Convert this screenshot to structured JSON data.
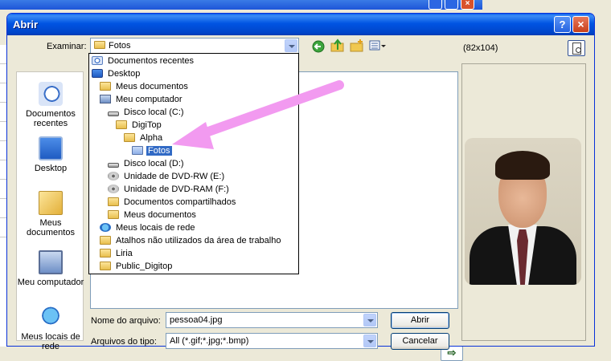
{
  "dialog": {
    "title": "Abrir",
    "help_icon": "?",
    "close_icon": "×"
  },
  "lookin": {
    "label": "Examinar:",
    "value": "Fotos"
  },
  "toolbar": {
    "icons": [
      "back-icon",
      "up-folder-icon",
      "new-folder-icon",
      "view-menu-icon"
    ]
  },
  "places": [
    {
      "label": "Documentos recentes",
      "icon": "recent-documents-icon"
    },
    {
      "label": "Desktop",
      "icon": "desktop-icon"
    },
    {
      "label": "Meus documentos",
      "icon": "my-documents-icon"
    },
    {
      "label": "Meu computador",
      "icon": "my-computer-icon"
    },
    {
      "label": "Meus locais de rede",
      "icon": "network-places-icon"
    }
  ],
  "dropdown": {
    "items": [
      {
        "label": "Documentos recentes",
        "indent": 0,
        "icon": "recent-icon"
      },
      {
        "label": "Desktop",
        "indent": 0,
        "icon": "desktop-icon"
      },
      {
        "label": "Meus documentos",
        "indent": 1,
        "icon": "folder-icon"
      },
      {
        "label": "Meu computador",
        "indent": 1,
        "icon": "computer-icon"
      },
      {
        "label": "Disco local (C:)",
        "indent": 2,
        "icon": "drive-icon"
      },
      {
        "label": "DigiTop",
        "indent": 3,
        "icon": "folder-icon"
      },
      {
        "label": "Alpha",
        "indent": 4,
        "icon": "folder-icon"
      },
      {
        "label": "Fotos",
        "indent": 5,
        "icon": "folder-icon",
        "selected": true
      },
      {
        "label": "Disco local (D:)",
        "indent": 2,
        "icon": "drive-icon"
      },
      {
        "label": "Unidade de DVD-RW (E:)",
        "indent": 2,
        "icon": "dvd-icon"
      },
      {
        "label": "Unidade de DVD-RAM (F:)",
        "indent": 2,
        "icon": "dvd-icon"
      },
      {
        "label": "Documentos compartilhados",
        "indent": 2,
        "icon": "folder-icon"
      },
      {
        "label": "Meus documentos",
        "indent": 2,
        "icon": "folder-icon"
      },
      {
        "label": "Meus locais de rede",
        "indent": 1,
        "icon": "network-icon"
      },
      {
        "label": "Atalhos não utilizados da área de trabalho",
        "indent": 1,
        "icon": "folder-icon"
      },
      {
        "label": "Liria",
        "indent": 1,
        "icon": "folder-icon"
      },
      {
        "label": "Public_Digitop",
        "indent": 1,
        "icon": "folder-icon"
      }
    ]
  },
  "preview": {
    "size_text": "(82x104)"
  },
  "filename": {
    "label": "Nome do arquivo:",
    "value": "pessoa04.jpg"
  },
  "filetype": {
    "label": "Arquivos do tipo:",
    "value": "All (*.gif;*.jpg;*.bmp)"
  },
  "buttons": {
    "open": "Abrir",
    "cancel": "Cancelar"
  },
  "background": {
    "go_glyph": "⇨"
  },
  "colors": {
    "title_bar": "#0054E3",
    "selection": "#316AC5",
    "annotation_arrow": "#F29AF0"
  }
}
